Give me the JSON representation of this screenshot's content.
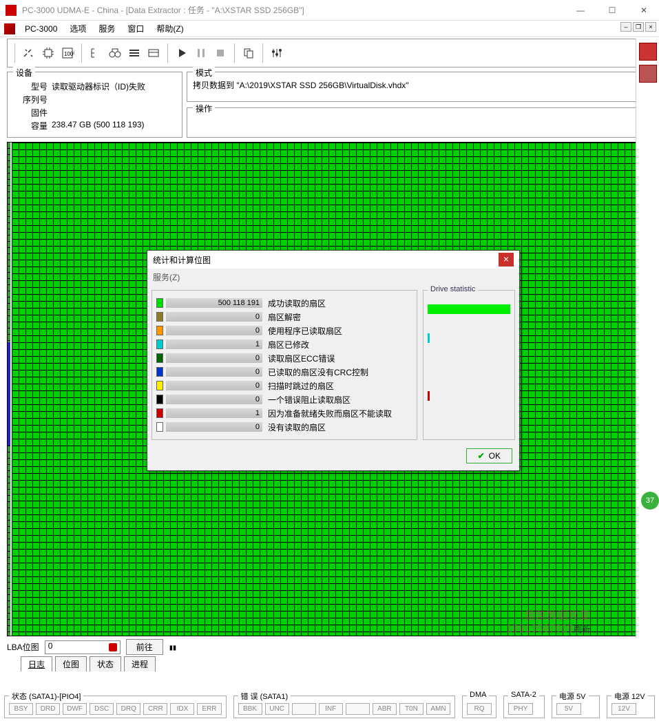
{
  "window": {
    "title": "PC-3000 UDMA-E - China - [Data Extractor : 任务 - \"A:\\XSTAR SSD 256GB\"]"
  },
  "menubar": {
    "app_label": "PC-3000",
    "items": [
      "选项",
      "服务",
      "窗口",
      "帮助(Z)"
    ]
  },
  "device_panel": {
    "title": "设备",
    "model_label": "型号",
    "model_value": "读取驱动器标识（ID)失败",
    "serial_label": "序列号",
    "firmware_label": "固件",
    "capacity_label": "容量",
    "capacity_value": "238.47 GB (500 118 193)"
  },
  "mode_panel": {
    "title": "模式",
    "value": "拷贝数据到 \"A:\\2019\\XSTAR SSD 256GB\\VirtualDisk.vhdx\""
  },
  "op_panel": {
    "title": "操作"
  },
  "dialog": {
    "title": "统计和计算位图",
    "menu": "服务(Z)",
    "drive_legend": "Drive statistic",
    "ok": "OK",
    "rows": [
      {
        "color": "#00e000",
        "count": "500 118 191",
        "label": "成功读取的扇区"
      },
      {
        "color": "#8a7a2a",
        "count": "0",
        "label": "扇区解密"
      },
      {
        "color": "#ff9900",
        "count": "0",
        "label": "使用程序已读取扇区"
      },
      {
        "color": "#00cccc",
        "count": "1",
        "label": "扇区已修改"
      },
      {
        "color": "#006600",
        "count": "0",
        "label": "读取扇区ECC错误"
      },
      {
        "color": "#0033cc",
        "count": "0",
        "label": "已读取的扇区没有CRC控制"
      },
      {
        "color": "#ffee00",
        "count": "0",
        "label": "扫描时跳过的扇区"
      },
      {
        "color": "#000000",
        "count": "0",
        "label": "一个错误阻止读取扇区"
      },
      {
        "color": "#cc0000",
        "count": "1",
        "label": "因为准备就绪失败而扇区不能读取"
      },
      {
        "color": "#ffffff",
        "count": "0",
        "label": "没有读取的扇区"
      }
    ]
  },
  "lba": {
    "label": "LBA位图",
    "value": "0",
    "goto": "前往",
    "refresh": "刷新"
  },
  "tabs": [
    "日志",
    "位图",
    "状态",
    "进程"
  ],
  "watermark": {
    "line1": "盘首数据恢复",
    "line2": "18913587628"
  },
  "badge": "37",
  "status": {
    "g1_title": "状态 (SATA1)-[PIO4]",
    "g1_items": [
      "BSY",
      "DRD",
      "DWF",
      "DSC",
      "DRQ",
      "CRR",
      "IDX",
      "ERR"
    ],
    "g2_title": "错 误 (SATA1)",
    "g2_items": [
      "BBK",
      "UNC",
      "",
      "INF",
      "",
      "ABR",
      "T0N",
      "AMN"
    ],
    "g3_title": "DMA",
    "g3_items": [
      "RQ"
    ],
    "g4_title": "SATA-2",
    "g4_items": [
      "PHY"
    ],
    "g5_title": "电源 5V",
    "g5_items": [
      "5V"
    ],
    "g6_title": "电源 12V",
    "g6_items": [
      "12V"
    ]
  }
}
